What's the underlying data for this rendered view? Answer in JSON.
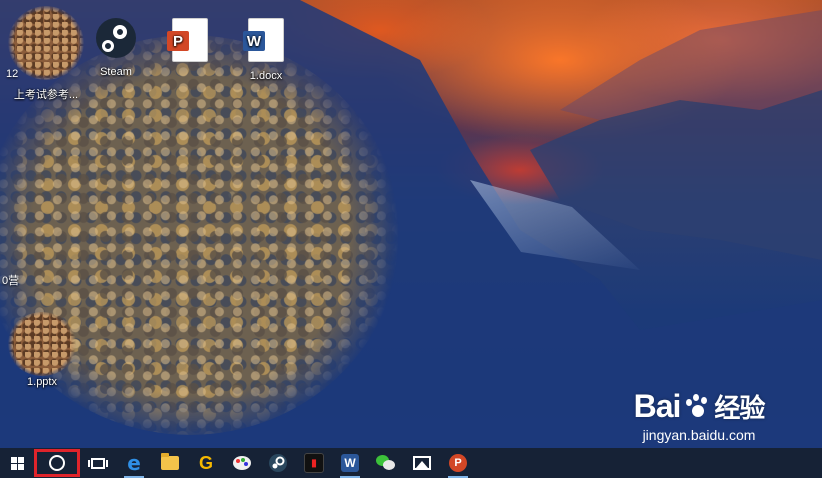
{
  "desktop": {
    "icons": [
      {
        "label": "上考试参考..."
      },
      {
        "label": "Steam"
      },
      {
        "label": ""
      },
      {
        "label": "1.docx"
      },
      {
        "label": "1.pptx"
      }
    ],
    "partial_labels": [
      "12",
      "0营"
    ]
  },
  "taskbar": {
    "items": [
      {
        "name": "start-button"
      },
      {
        "name": "cortana-search-button",
        "highlighted": true
      },
      {
        "name": "task-view-button"
      },
      {
        "name": "edge-icon"
      },
      {
        "name": "file-explorer-icon"
      },
      {
        "name": "google-icon"
      },
      {
        "name": "paint-icon"
      },
      {
        "name": "steam-icon"
      },
      {
        "name": "app-red-icon"
      },
      {
        "name": "word-icon",
        "text": "W"
      },
      {
        "name": "wechat-icon"
      },
      {
        "name": "photos-icon"
      },
      {
        "name": "powerpoint-icon",
        "text": "P"
      }
    ]
  },
  "watermark": {
    "logo_text": "Bai",
    "logo_text2": "经验",
    "url": "jingyan.baidu.com"
  },
  "colors": {
    "highlight": "#e0242b",
    "taskbar": "#162236",
    "word": "#2b579a",
    "powerpoint": "#d24726"
  }
}
